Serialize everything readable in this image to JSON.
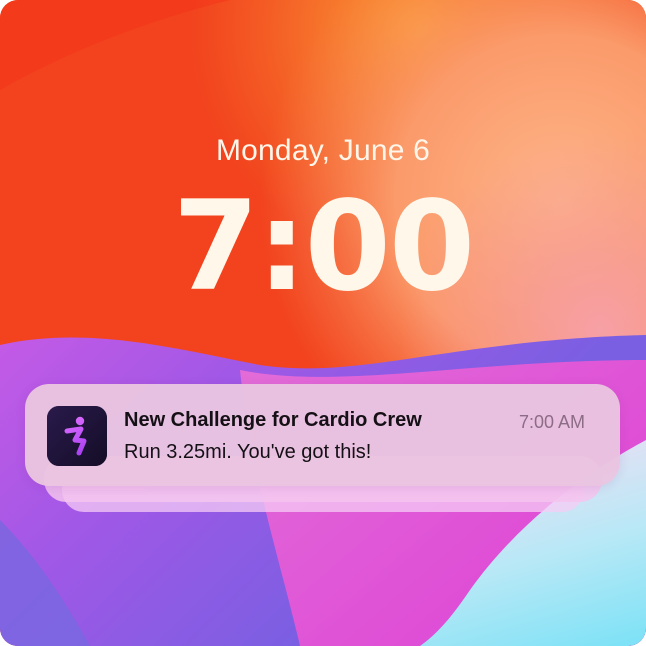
{
  "lock_screen": {
    "date": "Monday, June 6",
    "time": "7:00"
  },
  "notification": {
    "app_icon": "running-figure-icon",
    "title": "New Challenge for Cardio Crew",
    "timestamp": "7:00 AM",
    "body": "Run 3.25mi. You've got this!"
  },
  "colors": {
    "wallpaper_orange": "#f2421c",
    "wallpaper_peach": "#fba06c",
    "wallpaper_magenta": "#c452e6",
    "wallpaper_blue": "#8edcf2",
    "notification_bg": "#e9c4e0",
    "app_icon_bg": "#1e1438",
    "app_icon_accent": "#c24cf4",
    "text_primary": "#151015",
    "text_secondary": "#8c6c86",
    "clock_text": "#fff7ea"
  }
}
